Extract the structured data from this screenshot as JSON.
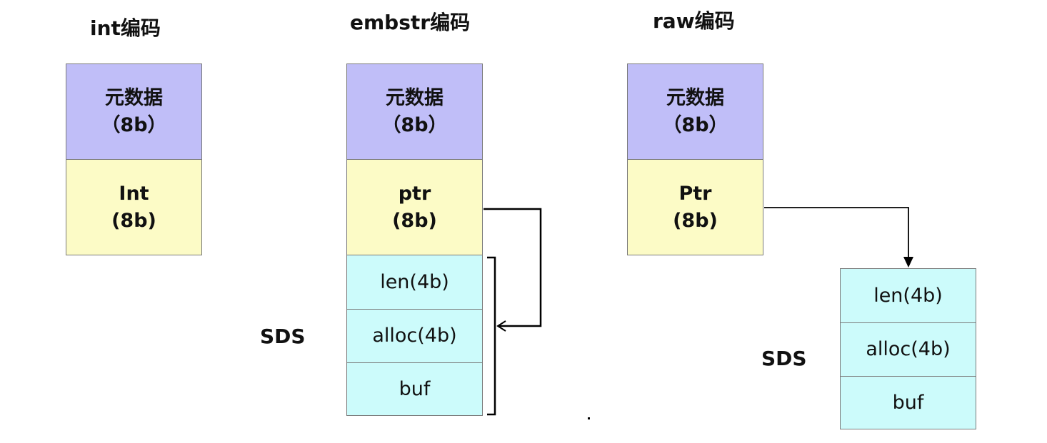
{
  "columns": {
    "int": {
      "title": "int编码",
      "meta": {
        "line1": "元数据",
        "line2": "（8b）"
      },
      "value": {
        "line1": "Int",
        "line2": "(8b)"
      }
    },
    "embstr": {
      "title": "embstr编码",
      "meta": {
        "line1": "元数据",
        "line2": "（8b）"
      },
      "value": {
        "line1": "ptr",
        "line2": "(8b)"
      },
      "sds_label": "SDS",
      "sds": {
        "len": "len(4b)",
        "alloc": "alloc(4b)",
        "buf": "buf"
      }
    },
    "raw": {
      "title": "raw编码",
      "meta": {
        "line1": "元数据",
        "line2": "（8b）"
      },
      "value": {
        "line1": "Ptr",
        "line2": "(8b)"
      },
      "sds_label": "SDS",
      "sds": {
        "len": "len(4b)",
        "alloc": "alloc(4b)",
        "buf": "buf"
      }
    }
  },
  "colors": {
    "meta": "#c0bef8",
    "value": "#fcfbc6",
    "sds": "#ccfbfb",
    "border": "#7a7a7a",
    "line": "#000000"
  }
}
